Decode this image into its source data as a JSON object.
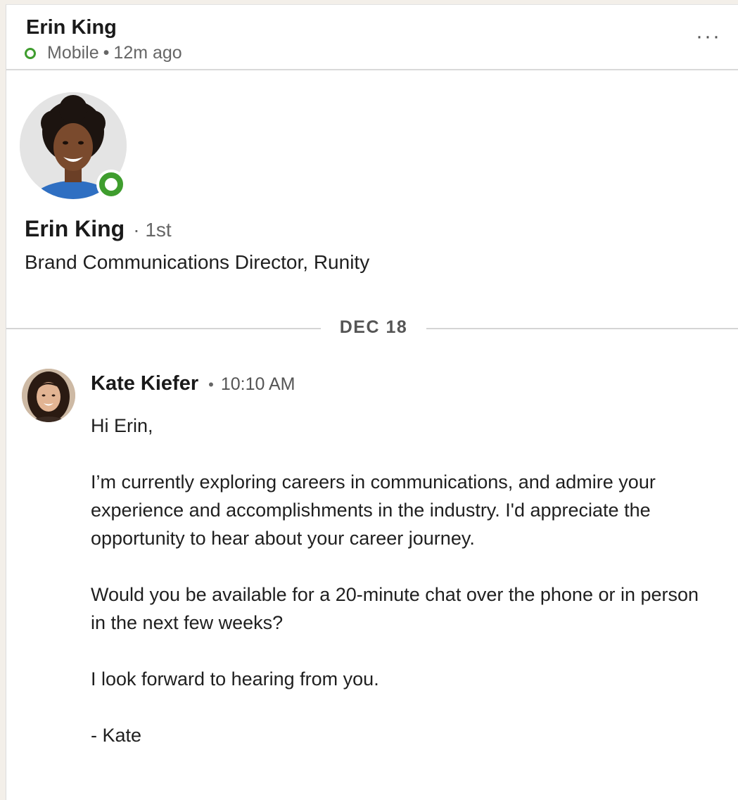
{
  "header": {
    "name": "Erin King",
    "status_device": "Mobile",
    "status_separator": "•",
    "status_time": "12m ago",
    "more_label": "···"
  },
  "profile": {
    "name": "Erin King",
    "degree": "· 1st",
    "headline": "Brand Communications Director, Runity"
  },
  "divider": {
    "date": "DEC 18"
  },
  "message": {
    "sender": "Kate Kiefer",
    "separator": "•",
    "time": "10:10 AM",
    "paragraphs": [
      "Hi Erin,",
      "I’m currently exploring careers in communications, and admire your experience and accomplishments in the industry. I'd appreciate the opportunity to hear about your career journey.",
      "Would you be available for a 20-minute chat over the phone or in person in the next few weeks?",
      "I look forward to hearing from you.",
      "- Kate"
    ]
  },
  "colors": {
    "presence_green": "#3f9d2e",
    "divider_gray": "#d4d4d4",
    "secondary_text": "#666666"
  }
}
